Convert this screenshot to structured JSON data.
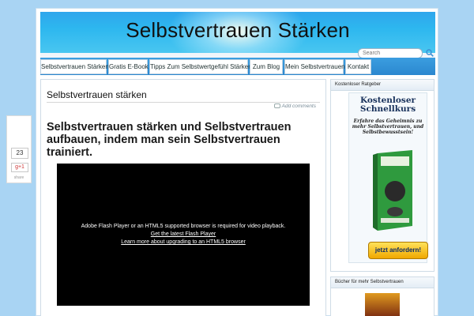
{
  "header": {
    "title": "Selbstvertrauen Stärken"
  },
  "search": {
    "placeholder": "Search",
    "icon": "search-icon"
  },
  "nav": {
    "items": [
      {
        "label": "Selbstvertrauen Stärken"
      },
      {
        "label": "Gratis E-Book"
      },
      {
        "label": "Tipps Zum Selbstwertgefühl Stärken"
      },
      {
        "label": "Zum Blog"
      },
      {
        "label": "Mein Selbstvertrauen"
      },
      {
        "label": "Kontakt"
      }
    ]
  },
  "post": {
    "title": "Selbstvertrauen stärken",
    "comments_label": "Add comments",
    "headline": "Selbstvertrauen stärken und Selbstvertrauen aufbauen, indem man sein Selbstvertrauen trainiert."
  },
  "video": {
    "message": "Adobe Flash Player or an HTML5 supported browser is required for video playback.",
    "link_flash": "Get the latest Flash Player",
    "link_html5": "Learn more about upgrading to an HTML5 browser"
  },
  "sidebar": {
    "widget1_title": "Kostenloser Ratgeber",
    "ad_title": "Kostenloser Schnellkurs",
    "ad_subtitle": "Erfahre das Geheimnis zu mehr Selbstvertrauen, und Selbstbewusstsein!",
    "ad_button": "jetzt anfordern!",
    "widget2_title": "Bücher für mehr Selbstvertrauen"
  },
  "share": {
    "count": "23",
    "gplus": "g+1",
    "label": "share"
  },
  "colors": {
    "nav_bar": "#2b87cf",
    "header": "#2fa6ec",
    "background": "#a9d4f3"
  }
}
